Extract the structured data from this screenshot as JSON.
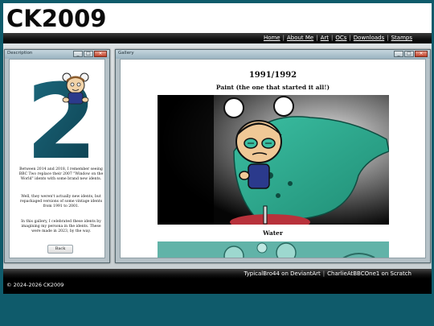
{
  "site": {
    "logo": "CK2009"
  },
  "nav": {
    "links": [
      "Home",
      "About Me",
      "Art",
      "OCs",
      "Downloads",
      "Stamps"
    ],
    "separator": "|"
  },
  "info_window": {
    "title": "Description",
    "big_number": "2",
    "paragraphs": [
      "Between 2014 and 2018, I remember seeing BBC Two replace their 2007 \"Window on the World\" idents with some brand new idents.",
      "Well, they weren't actually new idents, but repackaged versions of some vintage idents from 1991 to 2001.",
      "In this gallery, I celebrated these idents by imagining my persona in the idents. These were made in 2023, by the way."
    ],
    "back_label": "Back"
  },
  "gallery_window": {
    "title": "Gallery",
    "heading": "1991/1992",
    "items": [
      {
        "caption": "Paint (the one that started it all!)"
      },
      {
        "caption": "Water"
      }
    ]
  },
  "window_controls": {
    "minimize": "_",
    "maximize": "□",
    "close": "×"
  },
  "social": {
    "deviantart": "TypicalBro44 on DeviantArt",
    "separator": "|",
    "scratch": "CharlieAtBBCOne1 on Scratch"
  },
  "footer": {
    "copyright": "© 2024-2026 CK2009"
  },
  "colors": {
    "page_bg": "#0f5b6b",
    "paint_green": "#2ea88f",
    "header_bg": "#ffffff"
  }
}
